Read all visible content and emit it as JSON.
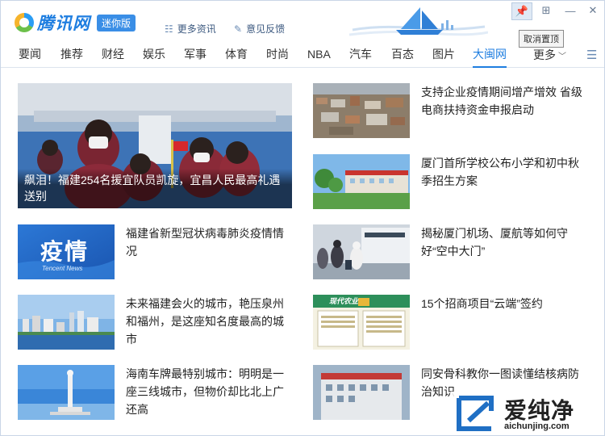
{
  "header": {
    "logo_text": "腾讯网",
    "badge": "迷你版",
    "more_news": "更多资讯",
    "feedback": "意见反馈",
    "tooltip": "取消置顶"
  },
  "nav": {
    "items": [
      "要闻",
      "推荐",
      "财经",
      "娱乐",
      "军事",
      "体育",
      "时尚",
      "NBA",
      "汽车",
      "百态",
      "图片",
      "大闽网"
    ],
    "active": "大闽网",
    "more": "更多"
  },
  "hero": {
    "title": "飙泪！福建254名援宜队员凯旋，宜昌人民最高礼遇送别"
  },
  "left_articles": [
    {
      "title": "福建省新型冠状病毒肺炎疫情情况",
      "thumb_text": "疫情",
      "thumb_sub": "Tencent News"
    },
    {
      "title": "未来福建会火的城市，艳压泉州和福州，是这座知名度最高的城市"
    },
    {
      "title": "海南车牌最特别城市：明明是一座三线城市，但物价却比北上广还高"
    }
  ],
  "right_articles": [
    {
      "title": "支持企业疫情期间增产增效 省级电商扶持资金申报启动"
    },
    {
      "title": "厦门首所学校公布小学和初中秋季招生方案"
    },
    {
      "title": "揭秘厦门机场、厦航等如何守好“空中大门”"
    },
    {
      "title": "15个招商项目“云端”签约",
      "thumb_text": "现代农业"
    },
    {
      "title": "同安骨科教你一图读懂结核病防治知识"
    }
  ],
  "watermark": {
    "name": "爱纯净",
    "url": "aichunjing.com"
  },
  "colors": {
    "accent": "#1f7ee0",
    "badge": "#3a8ee6"
  }
}
